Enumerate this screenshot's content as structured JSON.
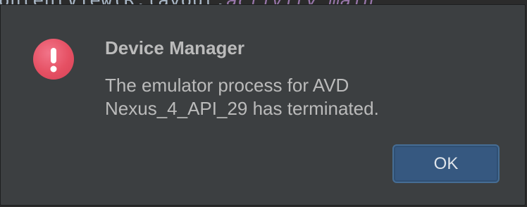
{
  "background_editor": {
    "code_text": "ontentView(R.layout.",
    "code_italic": "activity_main"
  },
  "dialog": {
    "title": "Device Manager",
    "message_lines": [
      "The emulator process for AVD",
      "Nexus_4_API_29 has terminated."
    ],
    "icon": "error-exclamation-icon",
    "ok_label": "OK"
  },
  "colors": {
    "dialog_bg": "#3c3f41",
    "text": "#bbbbbb",
    "icon_red": "#e55063",
    "button_bg": "#365880"
  }
}
